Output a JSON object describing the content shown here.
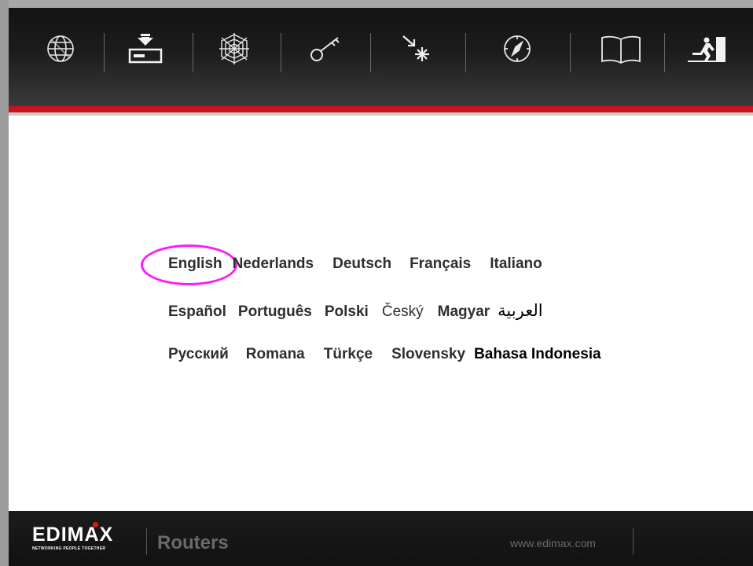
{
  "toolbar": {
    "icons": [
      {
        "name": "globe-icon"
      },
      {
        "name": "download-device-icon"
      },
      {
        "name": "spiderweb-icon"
      },
      {
        "name": "key-icon"
      },
      {
        "name": "sparkle-arrow-icon"
      },
      {
        "name": "compass-icon"
      },
      {
        "name": "book-icon"
      },
      {
        "name": "exit-icon"
      }
    ]
  },
  "languages": {
    "row1": [
      "English",
      "Nederlands",
      "Deutsch",
      "Français",
      "Italiano"
    ],
    "row2": [
      "Español",
      "Português",
      "Polski",
      "Český",
      "Magyar",
      "العربية"
    ],
    "row3": [
      "Русский",
      "Romana",
      "Türkçe",
      "Slovensky",
      "Bahasa Indonesia"
    ],
    "selected": "English"
  },
  "colors": {
    "accent_red": "#c8141c",
    "highlight_circle": "#ff1bf5"
  },
  "footer": {
    "brand": "EDIMAX",
    "tagline": "NETWORKING PEOPLE TOGETHER",
    "product": "Routers",
    "url": "www.edimax.com"
  }
}
